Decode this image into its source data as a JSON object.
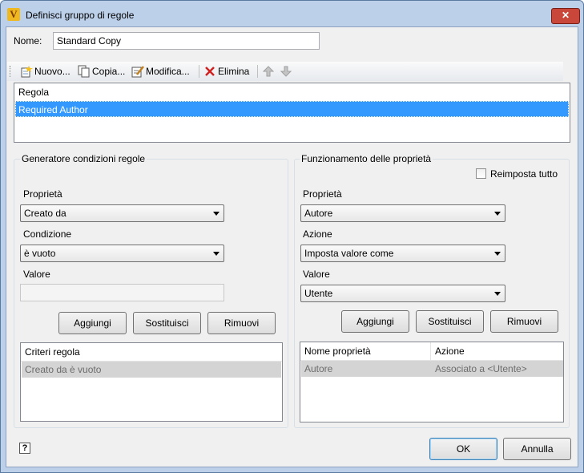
{
  "window": {
    "title": "Definisci gruppo di regole",
    "close_label": "✕"
  },
  "name_field": {
    "label": "Nome:",
    "value": "Standard Copy"
  },
  "toolbar": {
    "new_label": "Nuovo...",
    "copy_label": "Copia...",
    "edit_label": "Modifica...",
    "delete_label": "Elimina"
  },
  "rules_list": {
    "header": "Regola",
    "rows": [
      "Required Author"
    ]
  },
  "condition_builder": {
    "title": "Generatore condizioni regole",
    "property_label": "Proprietà",
    "property_value": "Creato da",
    "condition_label": "Condizione",
    "condition_value": "è vuoto",
    "value_label": "Valore",
    "value_value": "",
    "add_label": "Aggiungi",
    "replace_label": "Sostituisci",
    "remove_label": "Rimuovi",
    "criteria_header": "Criteri regola",
    "criteria_rows": [
      "Creato da è vuoto"
    ]
  },
  "property_behavior": {
    "title": "Funzionamento delle proprietà",
    "reset_all_label": "Reimposta tutto",
    "property_label": "Proprietà",
    "property_value": "Autore",
    "action_label": "Azione",
    "action_value": "Imposta valore come",
    "value_label": "Valore",
    "value_value": "Utente",
    "add_label": "Aggiungi",
    "replace_label": "Sostituisci",
    "remove_label": "Rimuovi",
    "table_headers": [
      "Nome proprietà",
      "Azione"
    ],
    "table_rows": [
      [
        "Autore",
        "Associato a <Utente>"
      ]
    ]
  },
  "footer": {
    "help_label": "?",
    "ok_label": "OK",
    "cancel_label": "Annulla"
  }
}
